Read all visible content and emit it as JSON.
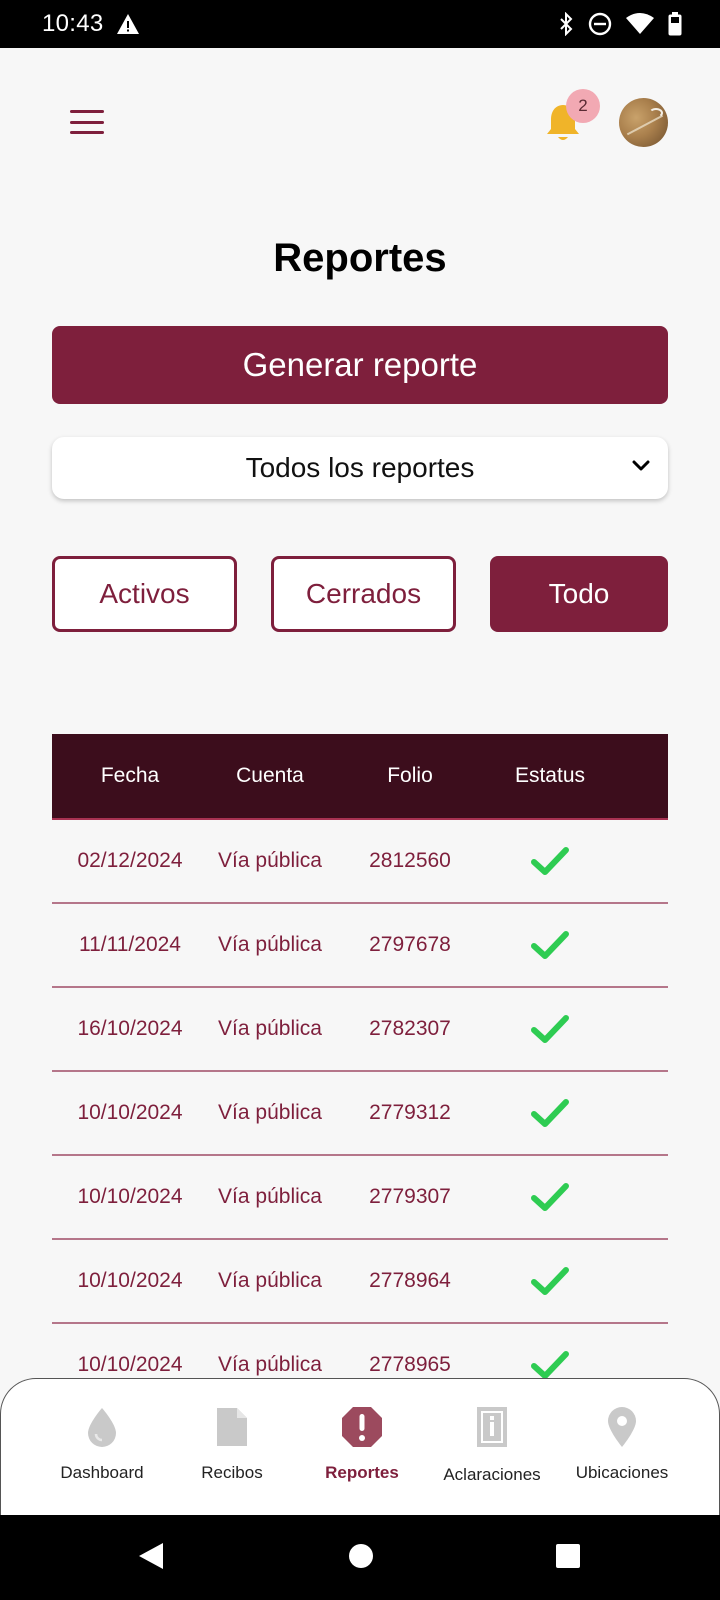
{
  "status_bar": {
    "time": "10:43"
  },
  "header": {
    "notification_count": "2"
  },
  "page": {
    "title": "Reportes"
  },
  "actions": {
    "generate_label": "Generar reporte"
  },
  "filter_select": {
    "selected": "Todos los reportes"
  },
  "filters": {
    "active": "Activos",
    "closed": "Cerrados",
    "all": "Todo",
    "selected": "all"
  },
  "table": {
    "headers": [
      "Fecha",
      "Cuenta",
      "Folio",
      "Estatus"
    ],
    "rows": [
      {
        "fecha": "02/12/2024",
        "cuenta": "Vía pública",
        "folio": "2812560",
        "estatus": "check-icon"
      },
      {
        "fecha": "11/11/2024",
        "cuenta": "Vía pública",
        "folio": "2797678",
        "estatus": "check-icon"
      },
      {
        "fecha": "16/10/2024",
        "cuenta": "Vía pública",
        "folio": "2782307",
        "estatus": "check-icon"
      },
      {
        "fecha": "10/10/2024",
        "cuenta": "Vía pública",
        "folio": "2779312",
        "estatus": "check-icon"
      },
      {
        "fecha": "10/10/2024",
        "cuenta": "Vía pública",
        "folio": "2779307",
        "estatus": "check-icon"
      },
      {
        "fecha": "10/10/2024",
        "cuenta": "Vía pública",
        "folio": "2778964",
        "estatus": "check-icon"
      },
      {
        "fecha": "10/10/2024",
        "cuenta": "Vía pública",
        "folio": "2778965",
        "estatus": "check-icon"
      }
    ]
  },
  "bottom_nav": {
    "items": [
      {
        "label": "Dashboard",
        "icon": "drop-icon"
      },
      {
        "label": "Recibos",
        "icon": "document-icon"
      },
      {
        "label": "Reportes",
        "icon": "alert-icon"
      },
      {
        "label": "Aclaraciones",
        "icon": "info-icon"
      },
      {
        "label": "Ubicaciones",
        "icon": "location-pin-icon"
      }
    ],
    "active": "Reportes"
  },
  "colors": {
    "brand": "#7e1f3c",
    "header_dark": "#3c0d1c",
    "bell": "#f0b429",
    "badge": "#f2a9b3",
    "check": "#2ecc52",
    "inactive_icon": "#c9c9c9"
  }
}
